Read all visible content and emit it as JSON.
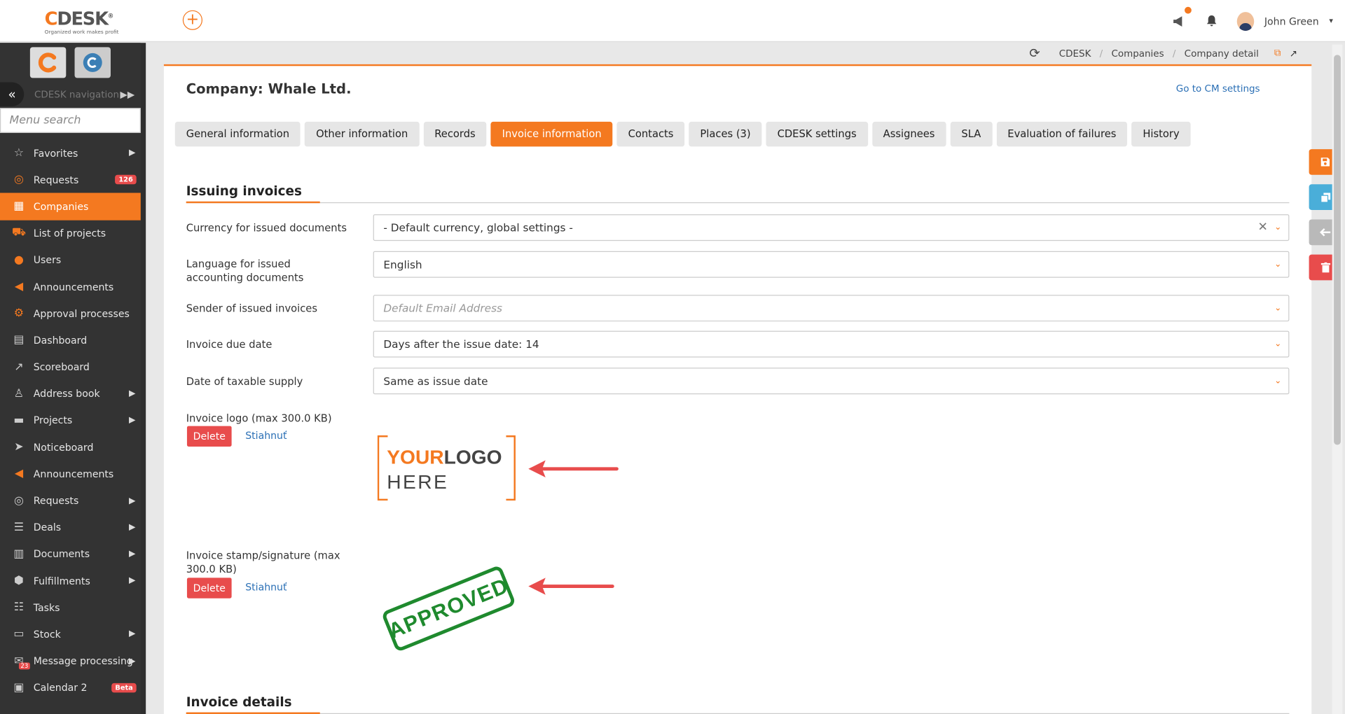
{
  "topbar": {
    "brand": "CDESK",
    "brand_reg": "®",
    "tagline": "Organized work makes profit",
    "add_symbol": "+",
    "user_name": "John Green",
    "user_caret": "▾"
  },
  "sidebar": {
    "nav_label": "CDESK navigation",
    "search_placeholder": "Menu search",
    "items": [
      {
        "label": "Favorites",
        "icon": "star-icon",
        "arrow": true
      },
      {
        "label": "Requests",
        "icon": "requests-icon",
        "badge": "126"
      },
      {
        "label": "Companies",
        "icon": "building-icon",
        "active": true
      },
      {
        "label": "List of projects",
        "icon": "truck-icon"
      },
      {
        "label": "Users",
        "icon": "user-icon"
      },
      {
        "label": "Announcements",
        "icon": "megaphone-icon"
      },
      {
        "label": "Approval processes",
        "icon": "bike-icon"
      },
      {
        "label": "Dashboard",
        "icon": "dashboard-icon"
      },
      {
        "label": "Scoreboard",
        "icon": "chart-icon"
      },
      {
        "label": "Address book",
        "icon": "address-book-icon",
        "arrow": true
      },
      {
        "label": "Projects",
        "icon": "projects-icon",
        "arrow": true
      },
      {
        "label": "Noticeboard",
        "icon": "paper-plane-icon"
      },
      {
        "label": "Announcements",
        "icon": "megaphone-icon"
      },
      {
        "label": "Requests",
        "icon": "requests-icon",
        "arrow": true
      },
      {
        "label": "Deals",
        "icon": "deals-icon",
        "arrow": true
      },
      {
        "label": "Documents",
        "icon": "documents-icon",
        "arrow": true
      },
      {
        "label": "Fulfillments",
        "icon": "box-icon",
        "arrow": true
      },
      {
        "label": "Tasks",
        "icon": "tasks-icon"
      },
      {
        "label": "Stock",
        "icon": "stock-icon",
        "arrow": true
      },
      {
        "label": "Message processing",
        "icon": "envelope-icon",
        "arrow": true,
        "mini_badge": "23"
      },
      {
        "label": "Calendar 2",
        "icon": "calendar-icon",
        "badge": "Beta"
      }
    ]
  },
  "breadcrumb": {
    "items": [
      "CDESK",
      "Companies",
      "Company detail"
    ],
    "separator": "/"
  },
  "page": {
    "title": "Company: Whale Ltd.",
    "cm_link": "Go to CM settings"
  },
  "tabs": [
    {
      "label": "General information"
    },
    {
      "label": "Other information"
    },
    {
      "label": "Records"
    },
    {
      "label": "Invoice information",
      "active": true
    },
    {
      "label": "Contacts"
    },
    {
      "label": "Places (3)"
    },
    {
      "label": "CDESK settings"
    },
    {
      "label": "Assignees"
    },
    {
      "label": "SLA"
    },
    {
      "label": "Evaluation of failures"
    },
    {
      "label": "History"
    }
  ],
  "issuing": {
    "heading": "Issuing invoices",
    "currency_label": "Currency for issued documents",
    "currency_value": "- Default currency, global settings -",
    "language_label": "Language for issued accounting documents",
    "language_value": "English",
    "sender_label": "Sender of issued invoices",
    "sender_placeholder": "Default Email Address",
    "due_label": "Invoice due date",
    "due_value": "Days after the issue date: 14",
    "taxable_label": "Date of taxable supply",
    "taxable_value": "Same as issue date",
    "logo_label": "Invoice logo (max 300.0 KB)",
    "logo_text_1a": "YOUR",
    "logo_text_1b": "LOGO",
    "logo_text_2": "HERE",
    "stamp_label": "Invoice stamp/signature (max 300.0 KB)",
    "stamp_text": "APPROVED",
    "delete_label": "Delete",
    "download_label": "Stiahnuť"
  },
  "details": {
    "heading": "Invoice details"
  },
  "colors": {
    "accent": "#f47920",
    "danger": "#e84c4c",
    "info": "#4aaed9",
    "neutral": "#b9b9b9",
    "stamp": "#1f8a2e"
  }
}
